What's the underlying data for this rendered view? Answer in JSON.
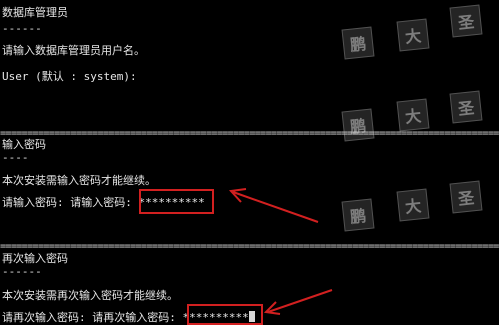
{
  "section1": {
    "title": "数据库管理员",
    "underline": "------",
    "prompt": "请输入数据库管理员用户名。",
    "user_line": "User (默认 : system):"
  },
  "separator": "======================================================================================================",
  "section2": {
    "title": "输入密码",
    "underline": "----",
    "info": "本次安装需输入密码才能继续。",
    "label": "请输入密码: 请输入密码: ",
    "value": "**********"
  },
  "section3": {
    "title": "再次输入密码",
    "underline": "------",
    "info": "本次安装需再次输入密码才能继续。",
    "label": "请再次输入密码: 请再次输入密码: ",
    "value": "**********"
  },
  "watermark": [
    "鹏",
    "大",
    "圣"
  ],
  "colors": {
    "background": "#000000",
    "text": "#e6e6e6",
    "annotation": "#d22020"
  }
}
